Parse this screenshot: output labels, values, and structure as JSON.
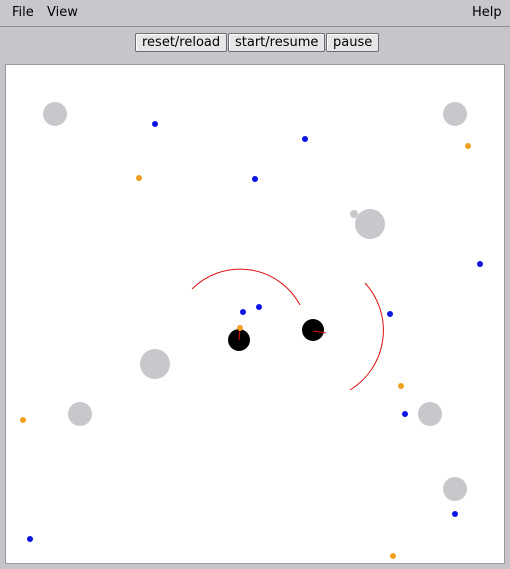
{
  "menubar": {
    "file": "File",
    "view": "View",
    "help": "Help"
  },
  "toolbar": {
    "reset_label": "reset/reload",
    "start_label": "start/resume",
    "pause_label": "pause"
  },
  "colors": {
    "obstacle": "#c8c7cb",
    "robot": "#000000",
    "sensor_arc": "#dd1111",
    "blue_target": "#0a14e6",
    "orange_target": "#f0a020"
  },
  "scene": {
    "obstacles": [
      {
        "id": "obstacle-1"
      },
      {
        "id": "obstacle-2"
      },
      {
        "id": "obstacle-3"
      },
      {
        "id": "obstacle-4"
      },
      {
        "id": "obstacle-5"
      },
      {
        "id": "obstacle-6"
      },
      {
        "id": "obstacle-7"
      },
      {
        "id": "obstacle-8"
      }
    ],
    "robots": [
      {
        "id": "robot-1"
      },
      {
        "id": "robot-2"
      }
    ],
    "blue_targets": 11,
    "orange_targets": 6
  }
}
